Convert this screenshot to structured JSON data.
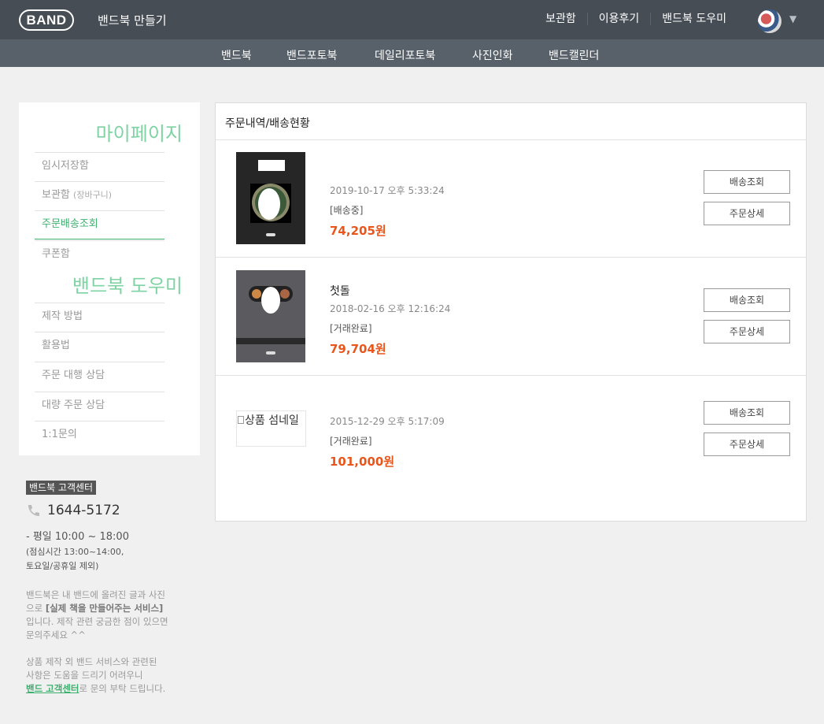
{
  "header": {
    "logo": "BAND",
    "title": "밴드북 만들기",
    "nav": [
      "보관함",
      "이용후기",
      "밴드북 도우미"
    ]
  },
  "subnav": [
    "밴드북",
    "밴드포토북",
    "데일리포토북",
    "사진인화",
    "밴드캘린더"
  ],
  "sidebar": {
    "mypage_heading": "마이페이지",
    "mypage_items": [
      {
        "label": "임시저장함"
      },
      {
        "label": "보관함",
        "sub": "(장바구니)"
      },
      {
        "label": "주문배송조회"
      },
      {
        "label": "쿠폰함"
      }
    ],
    "helper_heading": "밴드북 도우미",
    "helper_items": [
      "제작 방법",
      "활용법",
      "주문 대행 상담",
      "대량 주문 상담",
      "1:1문의"
    ]
  },
  "customer_center": {
    "badge": "밴드북 고객센터",
    "phone": "1644-5172",
    "hours": "- 평일 10:00 ~ 18:00",
    "hours_note_1": "(점심시간 13:00~14:00,",
    "hours_note_2": "토요일/공휴일 제외)",
    "desc_1": "밴드북은 내 밴드에 올려진 글과 사진",
    "desc_2a": "으로 ",
    "desc_2b": "[실제 책을 만들어주는 서비스]",
    "desc_3": "입니다. 제작 관련 궁금한 점이 있으면",
    "desc_4": "문의주세요 ^^",
    "desc2_1": "상품 제작 외 밴드 서비스와 관련된",
    "desc2_2": "사항은 도움을 드리기 어려우니",
    "desc2_link": "밴드 고객센터",
    "desc2_3": "로 문의 부탁 드립니다."
  },
  "main": {
    "title": "주문내역/배송현황",
    "orders": [
      {
        "title": "",
        "date": "2019-10-17 오후 5:33:24",
        "status": "[배송중]",
        "price": "74,205원",
        "track_label": "배송조회",
        "detail_label": "주문상세"
      },
      {
        "title": "첫돌",
        "date": "2018-02-16 오후 12:16:24",
        "status": "[거래완료]",
        "price": "79,704원",
        "track_label": "배송조회",
        "detail_label": "주문상세"
      },
      {
        "title": "",
        "date": "2015-12-29 오후 5:17:09",
        "status": "[거래완료]",
        "price": "101,000원",
        "track_label": "배송조회",
        "detail_label": "주문상세",
        "thumb_alt": "상품 섬네일"
      }
    ]
  },
  "icons": {
    "phone": "phone-icon",
    "caret": "caret-down-icon"
  },
  "colors": {
    "accent_green": "#3eb06e",
    "heading_green": "#7fd3a2",
    "price_orange": "#e8561c",
    "header_bg": "#464d55",
    "subnav_bg": "#58616a"
  }
}
